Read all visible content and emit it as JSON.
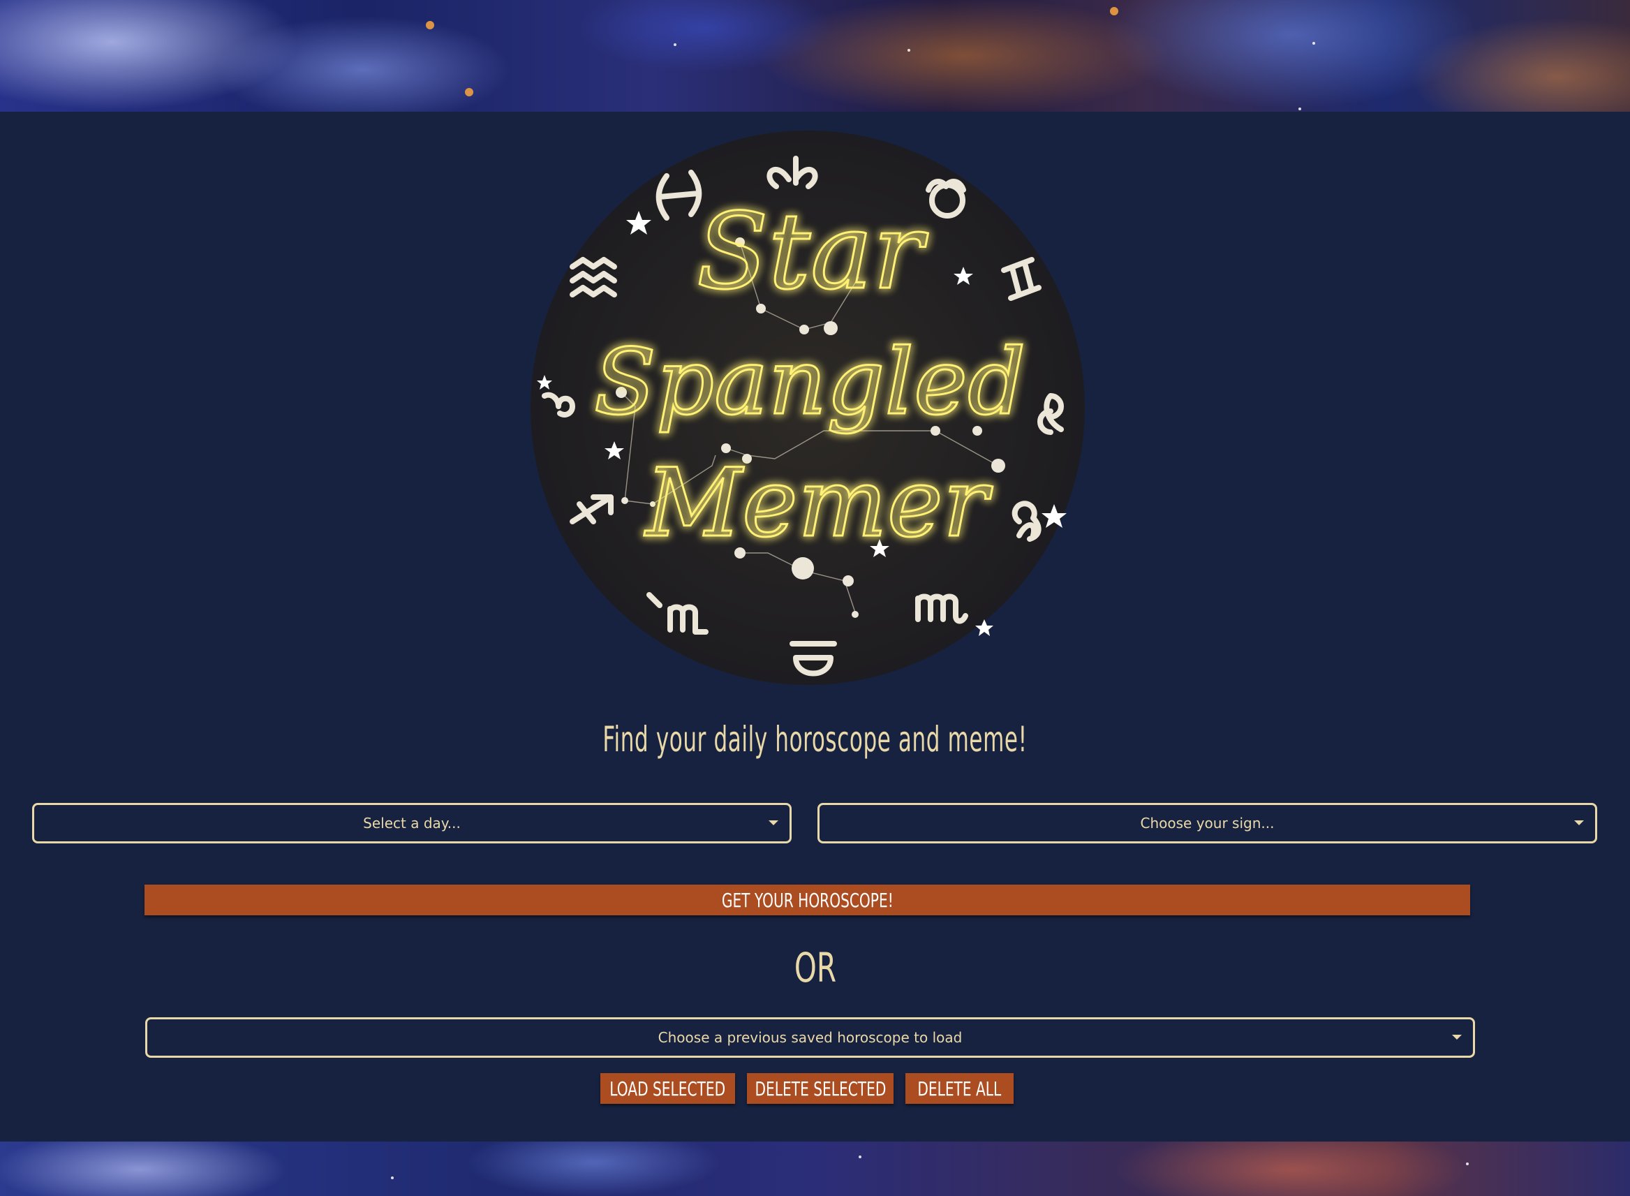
{
  "logo": {
    "title_lines": [
      "Star",
      "Spangled",
      "Memer"
    ],
    "zodiac_icons": [
      "aries-icon",
      "taurus-icon",
      "gemini-icon",
      "cancer-icon",
      "leo-icon",
      "virgo-icon",
      "libra-icon",
      "scorpio-icon",
      "sagittarius-icon",
      "capricorn-icon",
      "aquarius-icon",
      "pisces-icon"
    ]
  },
  "tagline": "Find your daily horoscope and meme!",
  "day_select": {
    "placeholder": "Select a day..."
  },
  "sign_select": {
    "placeholder": "Choose your sign..."
  },
  "get_button": {
    "label": "Get your horoscope!"
  },
  "or_text": "OR",
  "saved_select": {
    "placeholder": "Choose a previous saved horoscope to load"
  },
  "actions": {
    "load_label": "Load Selected",
    "delete_selected_label": "Delete Selected",
    "delete_all_label": "Delete All"
  },
  "colors": {
    "background": "#172240",
    "accent_button": "#ac4c21",
    "cream_text": "#ead9a8",
    "neon_yellow": "#fff176"
  }
}
